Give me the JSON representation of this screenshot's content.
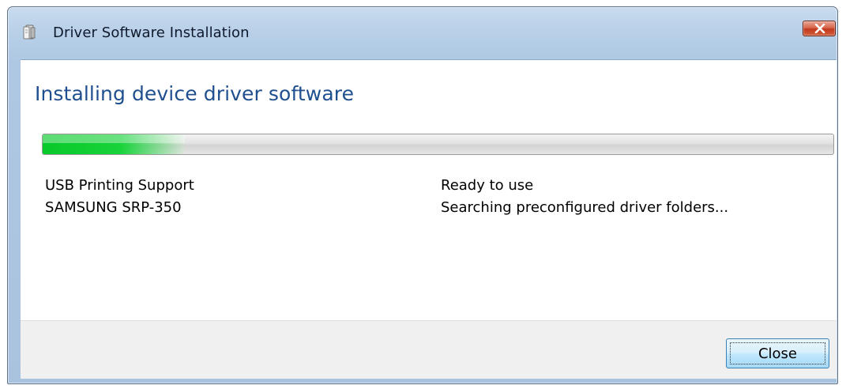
{
  "window": {
    "title": "Driver Software Installation"
  },
  "main": {
    "heading": "Installing device driver software",
    "progress_fraction": 0.18,
    "devices": [
      {
        "name": "USB Printing Support",
        "status": "Ready to use"
      },
      {
        "name": "SAMSUNG SRP-350",
        "status": "Searching preconfigured driver folders..."
      }
    ]
  },
  "footer": {
    "close_label": "Close"
  },
  "colors": {
    "heading": "#1f4f8f",
    "progress_fill": "#18d33a",
    "title_close": "#c2391c"
  },
  "icons": {
    "app": "driver-install-icon",
    "close": "close-icon"
  }
}
